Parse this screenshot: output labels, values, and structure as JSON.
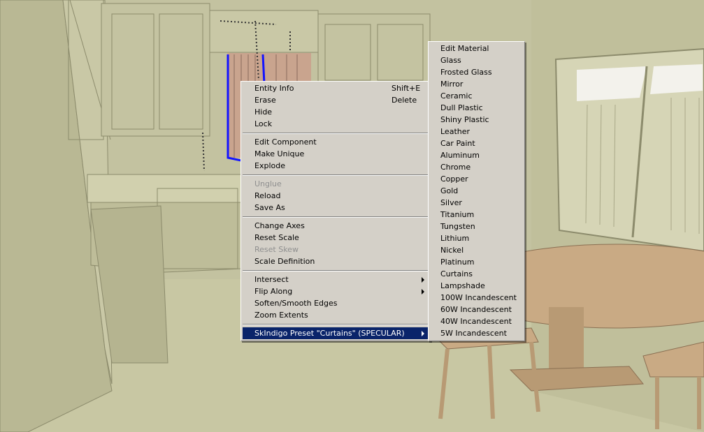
{
  "context_menu": {
    "groups": [
      [
        {
          "label": "Entity Info",
          "shortcut": "Shift+E"
        },
        {
          "label": "Erase",
          "shortcut": "Delete"
        },
        {
          "label": "Hide"
        },
        {
          "label": "Lock"
        }
      ],
      [
        {
          "label": "Edit Component"
        },
        {
          "label": "Make Unique"
        },
        {
          "label": "Explode"
        }
      ],
      [
        {
          "label": "Unglue",
          "disabled": true
        },
        {
          "label": "Reload"
        },
        {
          "label": "Save As"
        }
      ],
      [
        {
          "label": "Change Axes"
        },
        {
          "label": "Reset Scale"
        },
        {
          "label": "Reset Skew",
          "disabled": true
        },
        {
          "label": "Scale Definition"
        }
      ],
      [
        {
          "label": "Intersect",
          "submenu": true
        },
        {
          "label": "Flip Along",
          "submenu": true
        },
        {
          "label": "Soften/Smooth Edges"
        },
        {
          "label": "Zoom Extents"
        }
      ],
      [
        {
          "label": "SkIndigo Preset \"Curtains\" (SPECULAR)",
          "submenu": true,
          "highlighted": true
        }
      ]
    ]
  },
  "submenu": {
    "items": [
      "Edit Material",
      "Glass",
      "Frosted Glass",
      "Mirror",
      "Ceramic",
      "Dull Plastic",
      "Shiny Plastic",
      "Leather",
      "Car Paint",
      "Aluminum",
      "Chrome",
      "Copper",
      "Gold",
      "Silver",
      "Titanium",
      "Tungsten",
      "Lithium",
      "Nickel",
      "Platinum",
      "Curtains",
      "Lampshade",
      "100W Incandescent",
      "60W Incandescent",
      "40W Incandescent",
      "5W Incandescent"
    ]
  },
  "colors": {
    "menu_bg": "#d4d0c8",
    "highlight": "#0a246a",
    "selection": "#1414ff",
    "scene_wall": "#c7c6a6",
    "table": "#c9aa84"
  }
}
